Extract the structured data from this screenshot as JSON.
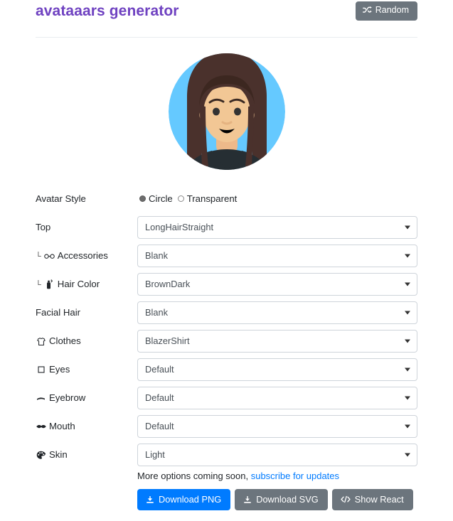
{
  "header": {
    "title": "avataaars generator",
    "random_button": {
      "label": "Random",
      "icon": "shuffle-icon"
    }
  },
  "avatar": {
    "alt": "generated avatar preview",
    "style": "Circle",
    "colors": {
      "background_circle": "#65c9ff",
      "hair": "#4a312c",
      "skin": "#f8d5ab",
      "clothes": "#262e33",
      "eyes": "#333333",
      "mouth": "#000000"
    }
  },
  "form": {
    "avatar_style": {
      "label": "Avatar Style",
      "options": [
        {
          "label": "Circle",
          "selected": true
        },
        {
          "label": "Transparent",
          "selected": false
        }
      ]
    },
    "fields": [
      {
        "label": "Top",
        "value": "LongHairStraight",
        "icon": null,
        "sub": false
      },
      {
        "label": "Accessories",
        "value": "Blank",
        "icon": "glasses-icon",
        "sub": true
      },
      {
        "label": "Hair Color",
        "value": "BrownDark",
        "icon": "spray-can-icon",
        "sub": true
      },
      {
        "label": "Facial Hair",
        "value": "Blank",
        "icon": null,
        "sub": false
      },
      {
        "label": "Clothes",
        "value": "BlazerShirt",
        "icon": "tshirt-icon",
        "sub": false
      },
      {
        "label": "Eyes",
        "value": "Default",
        "icon": "eye-square-icon",
        "sub": false
      },
      {
        "label": "Eyebrow",
        "value": "Default",
        "icon": "eyebrow-icon",
        "sub": false
      },
      {
        "label": "Mouth",
        "value": "Default",
        "icon": "mouth-icon",
        "sub": false
      },
      {
        "label": "Skin",
        "value": "Light",
        "icon": "palette-icon",
        "sub": false
      }
    ],
    "sub_marker": "└"
  },
  "footer": {
    "more_options_text": "More options coming soon,",
    "subscribe_link": "subscribe for updates",
    "buttons": [
      {
        "label": "Download PNG",
        "icon": "download-icon",
        "style": "primary"
      },
      {
        "label": "Download SVG",
        "icon": "download-icon",
        "style": "secondary"
      },
      {
        "label": "Show React",
        "icon": "code-icon",
        "style": "secondary"
      }
    ]
  },
  "colors": {
    "brand": "#6f42c1",
    "primary": "#007bff",
    "secondary": "#6c757d",
    "link": "#007bff",
    "border": "#ced4da"
  }
}
